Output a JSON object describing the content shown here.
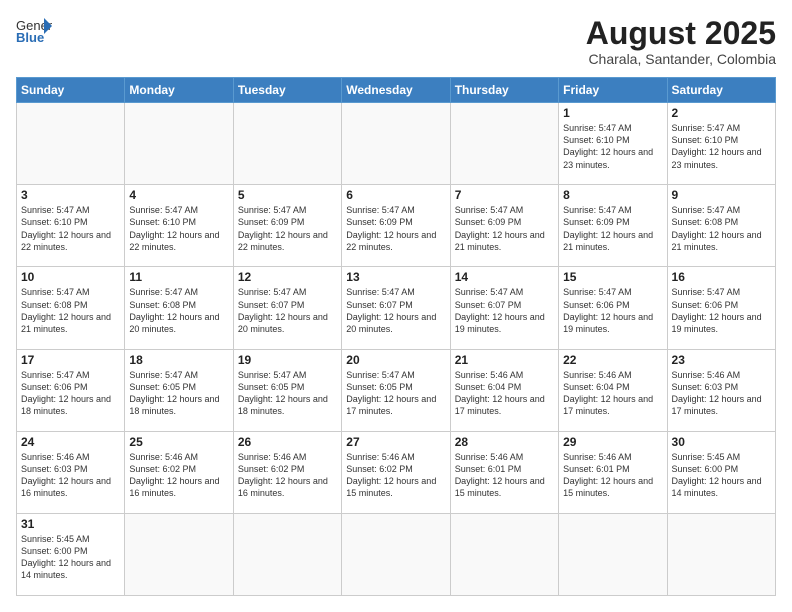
{
  "header": {
    "logo_general": "General",
    "logo_blue": "Blue",
    "month_title": "August 2025",
    "location": "Charala, Santander, Colombia"
  },
  "weekdays": [
    "Sunday",
    "Monday",
    "Tuesday",
    "Wednesday",
    "Thursday",
    "Friday",
    "Saturday"
  ],
  "weeks": [
    [
      {
        "day": "",
        "info": ""
      },
      {
        "day": "",
        "info": ""
      },
      {
        "day": "",
        "info": ""
      },
      {
        "day": "",
        "info": ""
      },
      {
        "day": "",
        "info": ""
      },
      {
        "day": "1",
        "info": "Sunrise: 5:47 AM\nSunset: 6:10 PM\nDaylight: 12 hours and 23 minutes."
      },
      {
        "day": "2",
        "info": "Sunrise: 5:47 AM\nSunset: 6:10 PM\nDaylight: 12 hours and 23 minutes."
      }
    ],
    [
      {
        "day": "3",
        "info": "Sunrise: 5:47 AM\nSunset: 6:10 PM\nDaylight: 12 hours and 22 minutes."
      },
      {
        "day": "4",
        "info": "Sunrise: 5:47 AM\nSunset: 6:10 PM\nDaylight: 12 hours and 22 minutes."
      },
      {
        "day": "5",
        "info": "Sunrise: 5:47 AM\nSunset: 6:09 PM\nDaylight: 12 hours and 22 minutes."
      },
      {
        "day": "6",
        "info": "Sunrise: 5:47 AM\nSunset: 6:09 PM\nDaylight: 12 hours and 22 minutes."
      },
      {
        "day": "7",
        "info": "Sunrise: 5:47 AM\nSunset: 6:09 PM\nDaylight: 12 hours and 21 minutes."
      },
      {
        "day": "8",
        "info": "Sunrise: 5:47 AM\nSunset: 6:09 PM\nDaylight: 12 hours and 21 minutes."
      },
      {
        "day": "9",
        "info": "Sunrise: 5:47 AM\nSunset: 6:08 PM\nDaylight: 12 hours and 21 minutes."
      }
    ],
    [
      {
        "day": "10",
        "info": "Sunrise: 5:47 AM\nSunset: 6:08 PM\nDaylight: 12 hours and 21 minutes."
      },
      {
        "day": "11",
        "info": "Sunrise: 5:47 AM\nSunset: 6:08 PM\nDaylight: 12 hours and 20 minutes."
      },
      {
        "day": "12",
        "info": "Sunrise: 5:47 AM\nSunset: 6:07 PM\nDaylight: 12 hours and 20 minutes."
      },
      {
        "day": "13",
        "info": "Sunrise: 5:47 AM\nSunset: 6:07 PM\nDaylight: 12 hours and 20 minutes."
      },
      {
        "day": "14",
        "info": "Sunrise: 5:47 AM\nSunset: 6:07 PM\nDaylight: 12 hours and 19 minutes."
      },
      {
        "day": "15",
        "info": "Sunrise: 5:47 AM\nSunset: 6:06 PM\nDaylight: 12 hours and 19 minutes."
      },
      {
        "day": "16",
        "info": "Sunrise: 5:47 AM\nSunset: 6:06 PM\nDaylight: 12 hours and 19 minutes."
      }
    ],
    [
      {
        "day": "17",
        "info": "Sunrise: 5:47 AM\nSunset: 6:06 PM\nDaylight: 12 hours and 18 minutes."
      },
      {
        "day": "18",
        "info": "Sunrise: 5:47 AM\nSunset: 6:05 PM\nDaylight: 12 hours and 18 minutes."
      },
      {
        "day": "19",
        "info": "Sunrise: 5:47 AM\nSunset: 6:05 PM\nDaylight: 12 hours and 18 minutes."
      },
      {
        "day": "20",
        "info": "Sunrise: 5:47 AM\nSunset: 6:05 PM\nDaylight: 12 hours and 17 minutes."
      },
      {
        "day": "21",
        "info": "Sunrise: 5:46 AM\nSunset: 6:04 PM\nDaylight: 12 hours and 17 minutes."
      },
      {
        "day": "22",
        "info": "Sunrise: 5:46 AM\nSunset: 6:04 PM\nDaylight: 12 hours and 17 minutes."
      },
      {
        "day": "23",
        "info": "Sunrise: 5:46 AM\nSunset: 6:03 PM\nDaylight: 12 hours and 17 minutes."
      }
    ],
    [
      {
        "day": "24",
        "info": "Sunrise: 5:46 AM\nSunset: 6:03 PM\nDaylight: 12 hours and 16 minutes."
      },
      {
        "day": "25",
        "info": "Sunrise: 5:46 AM\nSunset: 6:02 PM\nDaylight: 12 hours and 16 minutes."
      },
      {
        "day": "26",
        "info": "Sunrise: 5:46 AM\nSunset: 6:02 PM\nDaylight: 12 hours and 16 minutes."
      },
      {
        "day": "27",
        "info": "Sunrise: 5:46 AM\nSunset: 6:02 PM\nDaylight: 12 hours and 15 minutes."
      },
      {
        "day": "28",
        "info": "Sunrise: 5:46 AM\nSunset: 6:01 PM\nDaylight: 12 hours and 15 minutes."
      },
      {
        "day": "29",
        "info": "Sunrise: 5:46 AM\nSunset: 6:01 PM\nDaylight: 12 hours and 15 minutes."
      },
      {
        "day": "30",
        "info": "Sunrise: 5:45 AM\nSunset: 6:00 PM\nDaylight: 12 hours and 14 minutes."
      }
    ],
    [
      {
        "day": "31",
        "info": "Sunrise: 5:45 AM\nSunset: 6:00 PM\nDaylight: 12 hours and 14 minutes."
      },
      {
        "day": "",
        "info": ""
      },
      {
        "day": "",
        "info": ""
      },
      {
        "day": "",
        "info": ""
      },
      {
        "day": "",
        "info": ""
      },
      {
        "day": "",
        "info": ""
      },
      {
        "day": "",
        "info": ""
      }
    ]
  ]
}
